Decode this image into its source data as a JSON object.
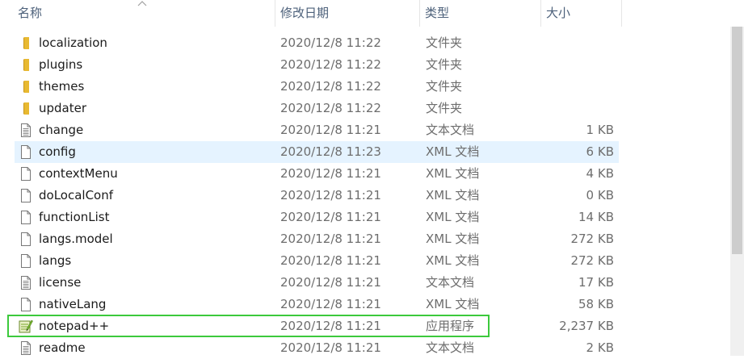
{
  "header": {
    "name": "名称",
    "modified": "修改日期",
    "type": "类型",
    "size": "大小"
  },
  "colors": {
    "folder": "#e8b931",
    "hover_row": "#e5f3ff",
    "highlight_border": "#3cc93c"
  },
  "files": [
    {
      "name": "localization",
      "date": "2020/12/8 11:22",
      "type": "文件夹",
      "size": "",
      "icon": "folder-icon"
    },
    {
      "name": "plugins",
      "date": "2020/12/8 11:22",
      "type": "文件夹",
      "size": "",
      "icon": "folder-icon"
    },
    {
      "name": "themes",
      "date": "2020/12/8 11:22",
      "type": "文件夹",
      "size": "",
      "icon": "folder-icon"
    },
    {
      "name": "updater",
      "date": "2020/12/8 11:22",
      "type": "文件夹",
      "size": "",
      "icon": "folder-icon"
    },
    {
      "name": "change",
      "date": "2020/12/8 11:21",
      "type": "文本文档",
      "size": "1 KB",
      "icon": "text-document-icon"
    },
    {
      "name": "config",
      "date": "2020/12/8 11:23",
      "type": "XML 文档",
      "size": "6 KB",
      "icon": "document-icon"
    },
    {
      "name": "contextMenu",
      "date": "2020/12/8 11:21",
      "type": "XML 文档",
      "size": "4 KB",
      "icon": "document-icon"
    },
    {
      "name": "doLocalConf",
      "date": "2020/12/8 11:21",
      "type": "XML 文档",
      "size": "0 KB",
      "icon": "document-icon"
    },
    {
      "name": "functionList",
      "date": "2020/12/8 11:21",
      "type": "XML 文档",
      "size": "14 KB",
      "icon": "document-icon"
    },
    {
      "name": "langs.model",
      "date": "2020/12/8 11:21",
      "type": "XML 文档",
      "size": "272 KB",
      "icon": "document-icon"
    },
    {
      "name": "langs",
      "date": "2020/12/8 11:21",
      "type": "XML 文档",
      "size": "272 KB",
      "icon": "document-icon"
    },
    {
      "name": "license",
      "date": "2020/12/8 11:21",
      "type": "文本文档",
      "size": "17 KB",
      "icon": "text-document-icon"
    },
    {
      "name": "nativeLang",
      "date": "2020/12/8 11:21",
      "type": "XML 文档",
      "size": "58 KB",
      "icon": "document-icon"
    },
    {
      "name": "notepad++",
      "date": "2020/12/8 11:21",
      "type": "应用程序",
      "size": "2,237 KB",
      "icon": "notepad-app-icon"
    },
    {
      "name": "readme",
      "date": "2020/12/8 11:21",
      "type": "文本文档",
      "size": "2 KB",
      "icon": "text-document-icon"
    }
  ]
}
